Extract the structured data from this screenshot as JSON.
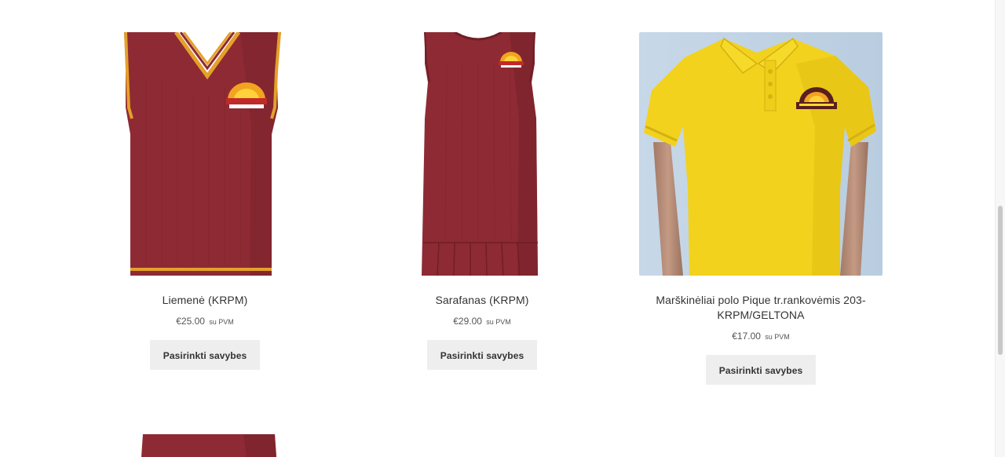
{
  "products": [
    {
      "title": "Liemenė (KRPM)",
      "price": "€25.00",
      "tax_label": "su PVM",
      "button_label": "Pasirinkti savybes",
      "image_icon": "knit-vest-burgundy"
    },
    {
      "title": "Sarafanas (KRPM)",
      "price": "€29.00",
      "tax_label": "su PVM",
      "button_label": "Pasirinkti savybes",
      "image_icon": "knit-pinafore-dress-burgundy"
    },
    {
      "title": "Marškinėliai polo Pique tr.rankovėmis 203-KRPM/GELTONA",
      "price": "€17.00",
      "tax_label": "su PVM",
      "button_label": "Pasirinkti savybes",
      "image_icon": "yellow-polo-shirt-on-mannequin"
    }
  ],
  "colors": {
    "burgundy": "#8e2a33",
    "gold_trim": "#e5a02a",
    "yellow_shirt": "#f2d21d",
    "button_bg": "#eeeeee"
  }
}
